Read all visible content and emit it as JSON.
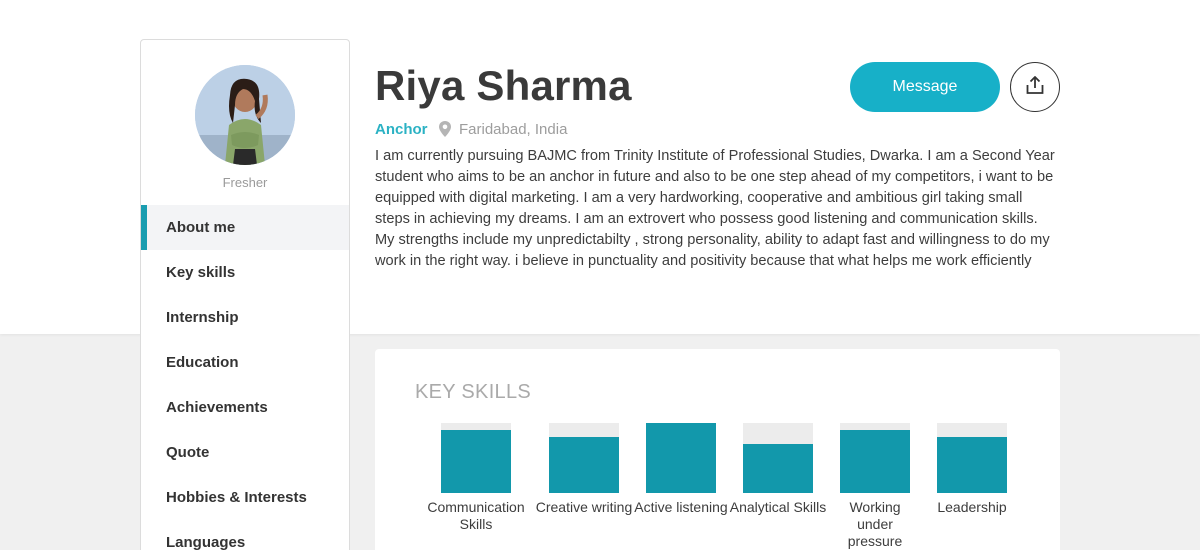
{
  "profile": {
    "name": "Riya Sharma",
    "role": "Anchor",
    "location": "Faridabad, India",
    "status": "Fresher",
    "bio": "I am currently pursuing BAJMC from Trinity Institute of Professional Studies, Dwarka. I am a Second Year student who aims to be an anchor in future and also to be one step ahead of my competitors, i want to be equipped with digital marketing. I am a very hardworking, cooperative and ambitious girl taking small steps in achieving my dreams. I am an extrovert who possess good listening and communication skills. My strengths include my unpredictabilty , strong personality, ability to adapt fast and willingness to do my work in the right way. i believe in punctuality and positivity because that what helps me work efficiently"
  },
  "actions": {
    "message_label": "Message",
    "share_icon": "share-icon"
  },
  "nav": {
    "items": [
      {
        "label": "About me",
        "active": true
      },
      {
        "label": "Key skills"
      },
      {
        "label": "Internship"
      },
      {
        "label": "Education"
      },
      {
        "label": "Achievements"
      },
      {
        "label": "Quote"
      },
      {
        "label": "Hobbies & Interests"
      },
      {
        "label": "Languages"
      }
    ]
  },
  "skills": {
    "title": "KEY SKILLS",
    "items": [
      {
        "label": "Communication Skills",
        "level": 0.9
      },
      {
        "label": "Creative writing",
        "level": 0.8
      },
      {
        "label": "Active listening",
        "level": 1.0
      },
      {
        "label": "Analytical Skills",
        "level": 0.7
      },
      {
        "label": "Working under pressure",
        "level": 0.9
      },
      {
        "label": "Leadership",
        "level": 0.8
      }
    ]
  },
  "colors": {
    "accent": "#17b0c8",
    "bar": "#1298ab",
    "role": "#2bb2c4"
  }
}
